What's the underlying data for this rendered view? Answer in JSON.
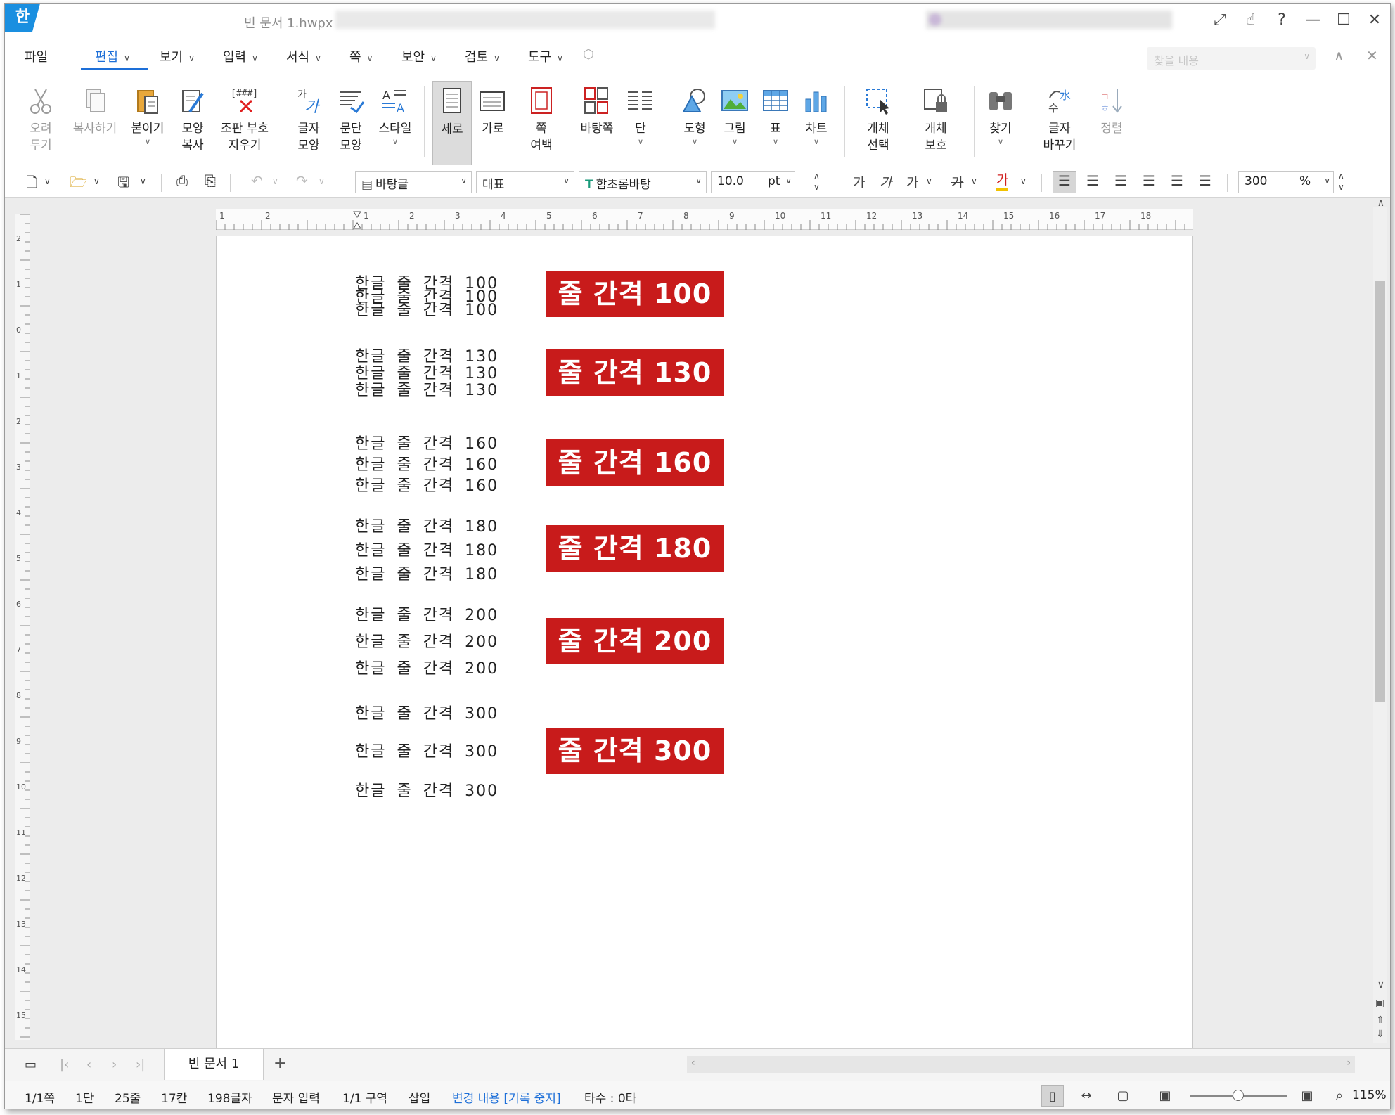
{
  "titlebar": {
    "app_icon": "한",
    "doc_title": "빈 문서 1.hwpx",
    "icons": [
      "expand-icon",
      "hand-icon",
      "help-icon",
      "minimize-icon",
      "maximize-icon",
      "close-icon"
    ],
    "icon_glyphs": [
      "⤢",
      "☝",
      "?",
      "—",
      "☐",
      "✕"
    ]
  },
  "menu": {
    "items": [
      "파일",
      "편집",
      "보기",
      "입력",
      "서식",
      "쪽",
      "보안",
      "검토",
      "도구"
    ],
    "active": "편집",
    "search_placeholder": "찾을 내용",
    "accent": "#1d6fd8"
  },
  "ribbon": {
    "groups": [
      {
        "id": "cut",
        "label": "오려\n두기",
        "disabled": true
      },
      {
        "id": "copy",
        "label": "복사하기",
        "disabled": true
      },
      {
        "id": "paste",
        "label": "붙이기"
      },
      {
        "id": "format-painter",
        "label": "모양\n복사"
      },
      {
        "id": "clear-markup",
        "label": "조판 부호\n지우기"
      },
      {
        "id": "char-shape",
        "label": "글자\n모양"
      },
      {
        "id": "para-shape",
        "label": "문단\n모양"
      },
      {
        "id": "style",
        "label": "스타일"
      },
      {
        "id": "portrait",
        "label": "세로",
        "pressed": true
      },
      {
        "id": "landscape",
        "label": "가로"
      },
      {
        "id": "page-margin",
        "label": "쪽\n여백"
      },
      {
        "id": "master-page",
        "label": "바탕쪽"
      },
      {
        "id": "columns",
        "label": "단"
      },
      {
        "id": "shape",
        "label": "도형"
      },
      {
        "id": "picture",
        "label": "그림"
      },
      {
        "id": "table",
        "label": "표"
      },
      {
        "id": "chart",
        "label": "차트"
      },
      {
        "id": "select-object",
        "label": "개체\n선택"
      },
      {
        "id": "protect-object",
        "label": "개체\n보호"
      },
      {
        "id": "find",
        "label": "찾기"
      },
      {
        "id": "replace-char",
        "label": "글자\n바꾸기"
      },
      {
        "id": "sort",
        "label": "정렬",
        "disabled": true
      }
    ]
  },
  "toolbar": {
    "style_select": "바탕글",
    "lang_select": "대표",
    "font_select": "함초롬바탕",
    "font_size": "10.0",
    "font_unit": "pt",
    "line_spacing": "300",
    "line_spacing_unit": "%",
    "char_buttons": [
      "가",
      "가",
      "가",
      "가",
      "가"
    ]
  },
  "ruler": {
    "h_numbers": [
      "2",
      "1",
      "1",
      "2",
      "3",
      "4",
      "5",
      "6",
      "7",
      "8",
      "9",
      "10",
      "11",
      "12",
      "13",
      "14",
      "15",
      "16",
      "17",
      "18"
    ],
    "v_numbers": [
      "2",
      "1",
      "0",
      "1",
      "2",
      "3",
      "4",
      "5",
      "6",
      "7",
      "8",
      "9",
      "10",
      "11",
      "12",
      "13",
      "14",
      "15"
    ]
  },
  "document": {
    "badge_color": "#c81b1b",
    "blocks": [
      {
        "lines": [
          "한글 줄 간격 100",
          "한글 줄 간격 100",
          "한글 줄 간격 100"
        ],
        "badge": "줄 간격 100"
      },
      {
        "lines": [
          "한글 줄 간격 130",
          "한글 줄 간격 130",
          "한글 줄 간격 130"
        ],
        "badge": "줄 간격 130"
      },
      {
        "lines": [
          "한글 줄 간격 160",
          "한글 줄 간격 160",
          "한글 줄 간격 160"
        ],
        "badge": "줄 간격 160"
      },
      {
        "lines": [
          "한글 줄 간격 180",
          "한글 줄 간격 180",
          "한글 줄 간격 180"
        ],
        "badge": "줄 간격 180"
      },
      {
        "lines": [
          "한글 줄 간격 200",
          "한글 줄 간격 200",
          "한글 줄 간격 200"
        ],
        "badge": "줄 간격 200"
      },
      {
        "lines": [
          "한글 줄 간격 300",
          "한글 줄 간격 300",
          "한글 줄 간격 300"
        ],
        "badge": "줄 간격 300"
      }
    ]
  },
  "tabs": {
    "doc_tab": "빈 문서 1",
    "add_label": "+"
  },
  "status": {
    "page": "1/1쪽",
    "column": "1단",
    "line": "25줄",
    "col": "17칸",
    "chars": "198글자",
    "mode": "문자 입력",
    "section": "1/1 구역",
    "insert": "삽입",
    "track_changes": "변경 내용 [기록 중지]",
    "typing_speed": "타수 : 0타",
    "zoom": "115%",
    "zoom_level_percent": 115
  }
}
